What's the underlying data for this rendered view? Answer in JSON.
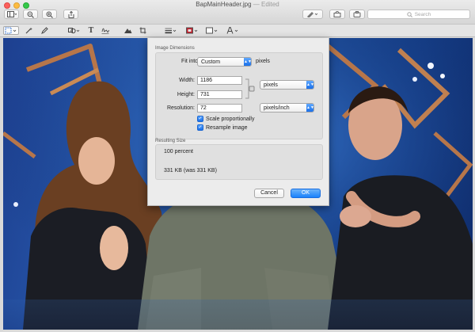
{
  "window": {
    "filename": "BapMainHeader.jpg",
    "separator": "—",
    "status": "Edited"
  },
  "toolbar": {
    "search_placeholder": "Search"
  },
  "dialog": {
    "image_dimensions_label": "Image Dimensions",
    "fit_into_label": "Fit into:",
    "fit_into_value": "Custom",
    "fit_into_unit": "pixels",
    "width_label": "Width:",
    "width_value": "1186",
    "height_label": "Height:",
    "height_value": "731",
    "dimension_unit": "pixels",
    "resolution_label": "Resolution:",
    "resolution_value": "72",
    "resolution_unit": "pixels/inch",
    "scale_proportionally_label": "Scale proportionally",
    "scale_proportionally_checked": true,
    "resample_label": "Resample image",
    "resample_checked": true,
    "resulting_size_label": "Resulting Size",
    "percent_text": "100 percent",
    "size_text": "331 KB (was 331 KB)",
    "cancel_label": "Cancel",
    "ok_label": "OK"
  },
  "colors": {
    "accent": "#1a82fb",
    "stage_blue": "#2a5fb4"
  }
}
